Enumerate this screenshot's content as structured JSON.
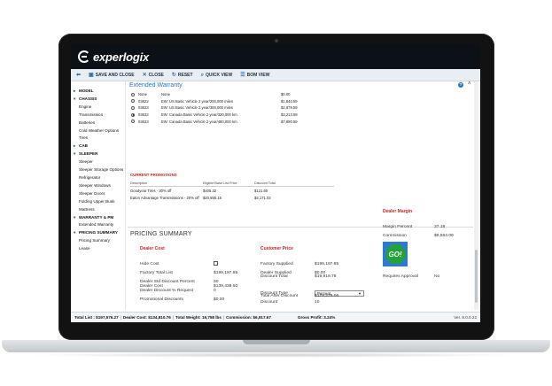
{
  "app": {
    "brand": "experlogix"
  },
  "toolbar": {
    "items": [
      {
        "icon": "back-arrow-icon",
        "label": ""
      },
      {
        "icon": "save-icon",
        "label": "SAVE AND CLOSE"
      },
      {
        "icon": "close-x-icon",
        "label": "CLOSE"
      },
      {
        "icon": "reset-icon",
        "label": "RESET"
      },
      {
        "icon": "search-icon",
        "label": "QUICK VIEW"
      },
      {
        "icon": "bom-icon",
        "label": "BOM VIEW"
      }
    ]
  },
  "sidebar": {
    "items": [
      {
        "label": "MODEL",
        "group": true
      },
      {
        "label": "CHASSIS",
        "group": true
      },
      {
        "label": "Engine",
        "group": false
      },
      {
        "label": "Transmission",
        "group": false
      },
      {
        "label": "Batteries",
        "group": false
      },
      {
        "label": "Cold Weather Options",
        "group": false
      },
      {
        "label": "Tires",
        "group": false
      },
      {
        "label": "CAB",
        "group": true
      },
      {
        "label": "SLEEPER",
        "group": true
      },
      {
        "label": "Sleeper",
        "group": false
      },
      {
        "label": "Sleeper Storage Options",
        "group": false
      },
      {
        "label": "Refrigerator",
        "group": false
      },
      {
        "label": "Sleeper Windows",
        "group": false
      },
      {
        "label": "Sleeper Doors",
        "group": false
      },
      {
        "label": "Folding Upper Bunk",
        "group": false
      },
      {
        "label": "Mattress",
        "group": false
      },
      {
        "label": "WARRANTY & PM",
        "group": true
      },
      {
        "label": "Extended Warranty",
        "group": false
      },
      {
        "label": "PRICING SUMMARY",
        "group": true
      },
      {
        "label": "Pricing Summary",
        "group": false
      },
      {
        "label": "Lease",
        "group": false
      }
    ]
  },
  "extended_warranty": {
    "title": "Extended Warranty",
    "rows": [
      {
        "selected": false,
        "code": "None",
        "desc": "None",
        "price": "$0.00"
      },
      {
        "selected": false,
        "code": "03622",
        "desc": "EW: US Basic Vehicle 2 year/200,000 miles",
        "price": "$1,840.59"
      },
      {
        "selected": false,
        "code": "03623",
        "desc": "EW: US Basic Vehicle 2 year/300,000 miles",
        "price": "$2,879.59"
      },
      {
        "selected": true,
        "code": "03632",
        "desc": "EW: Canada Basic Vehicle 2 year/320,000 km",
        "price": "$3,213.59"
      },
      {
        "selected": false,
        "code": "03633",
        "desc": "EW: Canada Basic Vehicle 2 year/480,000 km",
        "price": "$7,890.59"
      }
    ]
  },
  "promotions": {
    "title": "CURRENT PROMOTIONS",
    "headers": [
      "Description",
      "Eligible Base List Price",
      "Discount Total"
    ],
    "rows": [
      [
        "Goodyear Tires - 30% off",
        "$405.32",
        "$121.60"
      ],
      [
        "Eaton Advantage Transmissions - 20% off",
        "$20,855.15",
        "$4,171.03"
      ]
    ]
  },
  "pricing": {
    "title": "PRICING SUMMARY",
    "dealer_cost": {
      "heading": "Dealer Cost",
      "hide_cost_label": "Hide Cost",
      "factory_total_list_label": "Factory Total List",
      "factory_total_list": "$199,197.85",
      "std_discount_label": "Dealer Std Discount Percent",
      "std_discount": "30",
      "discount_request_label": "Dealer Discount % Request",
      "discount_request": "0",
      "promo_discounts_label": "Promotional Discounts",
      "promo_discounts": "$0.00",
      "dealer_cost_label": "Dealer Cost",
      "dealer_cost": "$139,438.50"
    },
    "customer_price": {
      "heading": "Customer Price",
      "factory_supplied_label": "Factory Supplied",
      "factory_supplied": "$199,197.85",
      "dealer_supplied_label": "Dealer Supplied",
      "dealer_supplied": "$0.00",
      "discount_type_label": "Discount Type",
      "discount_type": "Percent",
      "discount_label": "Discount",
      "discount": "10",
      "discount_total_label": "Discount Total",
      "discount_total": "$19,919.78",
      "total_after_label": "Total After Discount",
      "total_after": "$179,278.06"
    },
    "dealer_margin": {
      "heading": "Dealer Margin",
      "margin_percent_label": "Margin Percent",
      "margin_percent": "37.18",
      "commission_label": "Commission",
      "commission": "$9,564.00",
      "go_label": "GO!",
      "approval_label": "Requires Approval",
      "approval": "No"
    }
  },
  "status": {
    "total_list": "Total List : $197,576.27",
    "dealer_cost": "Dealer Cost: $134,810.76",
    "total_weight": "Total Weight: 19,758 lbs",
    "commission": "Commission: $6,917.67",
    "gross_profit": "Gross Profit: 3.24%",
    "version": "Ver. 8.0.0.22"
  },
  "colors": {
    "accent": "#2a73c4",
    "heading_red": "#c22727",
    "brandbar": "#0b1116"
  }
}
